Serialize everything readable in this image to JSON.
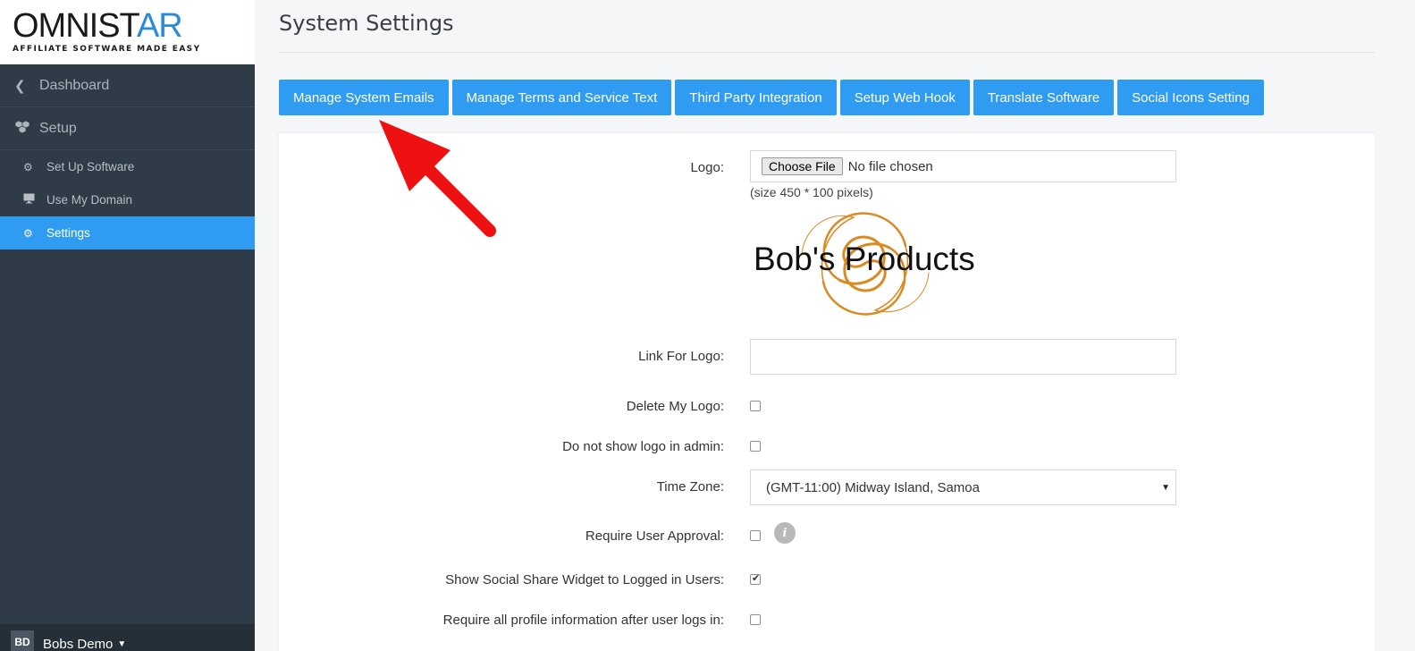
{
  "brand": {
    "name_part1": "OMNIST",
    "name_part2": "AR",
    "tagline": "AFFILIATE SOFTWARE MADE EASY"
  },
  "sidebar": {
    "dashboard": "Dashboard",
    "setup": "Setup",
    "items": [
      {
        "label": "Set Up Software",
        "icon": "gears-icon"
      },
      {
        "label": "Use My Domain",
        "icon": "monitor-icon"
      },
      {
        "label": "Settings",
        "icon": "gear-icon",
        "active": true
      }
    ],
    "user": {
      "initials": "BD",
      "name": "Bobs Demo"
    }
  },
  "page": {
    "title": "System Settings"
  },
  "tabs": [
    "Manage System Emails",
    "Manage Terms and Service Text",
    "Third Party Integration",
    "Setup Web Hook",
    "Translate Software",
    "Social Icons Setting"
  ],
  "form": {
    "logo_label": "Logo:",
    "choose_file": "Choose File",
    "no_file": "No file chosen",
    "size_hint": "(size 450 * 100 pixels)",
    "logo_preview_text": "Bob's Products",
    "link_label": "Link For Logo:",
    "link_value": "",
    "delete_label": "Delete My Logo:",
    "delete_checked": false,
    "noshow_label": "Do not show logo in admin:",
    "noshow_checked": false,
    "tz_label": "Time Zone:",
    "tz_value": "(GMT-11:00) Midway Island, Samoa",
    "approval_label": "Require User Approval:",
    "approval_checked": false,
    "share_label": "Show Social Share Widget to Logged in Users:",
    "share_checked": true,
    "profile_label": "Require all profile information after user logs in:",
    "profile_checked": false
  },
  "colors": {
    "accent": "#2f9cf1",
    "sidebar_bg": "#2f3b46",
    "arrow": "#ee1111",
    "logo_swirl": "#d98a22"
  }
}
